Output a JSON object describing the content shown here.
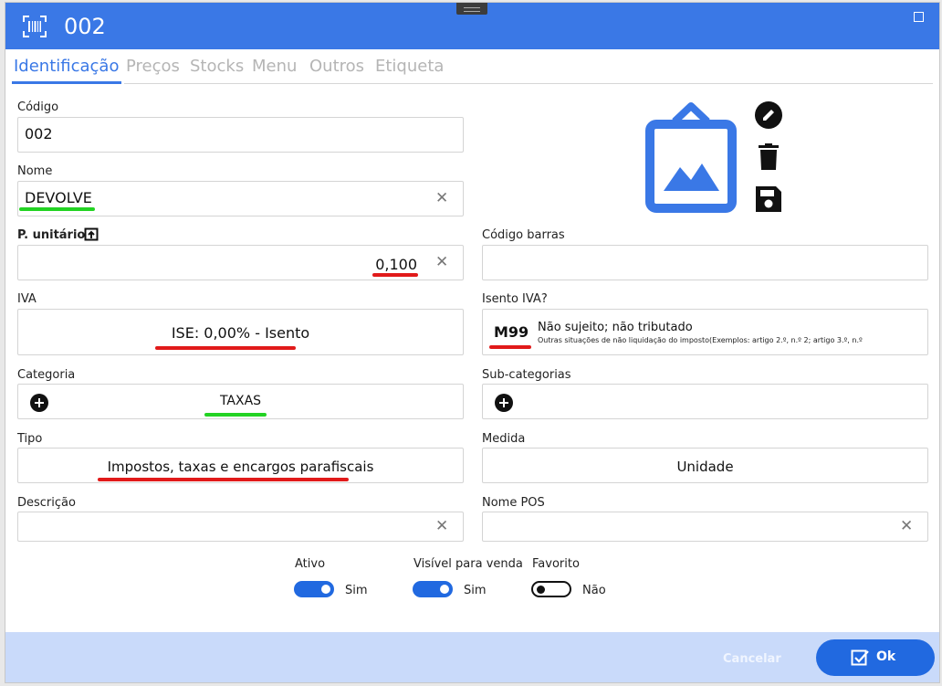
{
  "window": {
    "title": "002"
  },
  "tabs": [
    {
      "label": "Identificação",
      "active": true
    },
    {
      "label": "Preços"
    },
    {
      "label": "Stocks"
    },
    {
      "label": "Menu"
    },
    {
      "label": "Outros"
    },
    {
      "label": "Etiqueta"
    }
  ],
  "form": {
    "codigo": {
      "label": "Código",
      "value": "002"
    },
    "nome": {
      "label": "Nome",
      "value": "DEVOLVE"
    },
    "preco_unitario": {
      "label": "P. unitário",
      "value": "0,100"
    },
    "codigo_barras": {
      "label": "Código barras",
      "value": ""
    },
    "iva": {
      "label": "IVA",
      "value": "ISE: 0,00% - Isento"
    },
    "isento_iva": {
      "label": "Isento IVA?",
      "code": "M99",
      "title": "Não sujeito; não tributado",
      "detail": "Outras situações de não liquidação do imposto(Exemplos: artigo 2.º, n.º 2; artigo 3.º, n.º"
    },
    "categoria": {
      "label": "Categoria",
      "value": "TAXAS"
    },
    "subcategorias": {
      "label": "Sub-categorias",
      "value": ""
    },
    "tipo": {
      "label": "Tipo",
      "value": "Impostos, taxas e encargos parafiscais"
    },
    "medida": {
      "label": "Medida",
      "value": "Unidade"
    },
    "descricao": {
      "label": "Descrição",
      "value": ""
    },
    "nome_pos": {
      "label": "Nome POS",
      "value": ""
    }
  },
  "toggles": {
    "ativo": {
      "label": "Ativo",
      "state": true,
      "value_label": "Sim"
    },
    "visivel": {
      "label": "Visível para venda",
      "state": true,
      "value_label": "Sim"
    },
    "favorito": {
      "label": "Favorito",
      "state": false,
      "value_label": "Não"
    }
  },
  "footer": {
    "cancel": "Cancelar",
    "ok": "Ok"
  },
  "colors": {
    "accent": "#3a78e6",
    "footer_bg": "#c9dafa",
    "highlight_green": "#23d323",
    "highlight_red": "#e11a1a"
  },
  "icons": [
    "barcode-icon",
    "maximize-icon",
    "image-placeholder-icon",
    "edit-icon",
    "delete-icon",
    "save-icon",
    "paste-icon",
    "clear-icon",
    "add-icon",
    "checkbox-icon"
  ]
}
